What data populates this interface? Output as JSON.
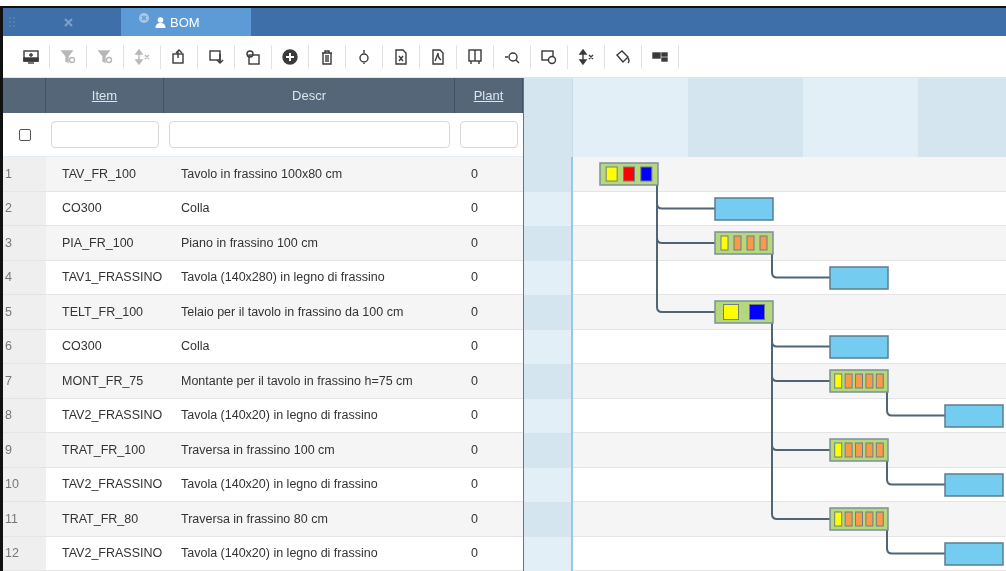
{
  "tabs": [
    {
      "selected": false,
      "closable": true
    },
    {
      "label": "BOM",
      "selected": true,
      "closable": true
    }
  ],
  "toolbar": [
    {
      "kind": "monitor",
      "disabled": false
    },
    {
      "kind": "filter-clear",
      "disabled": true
    },
    {
      "kind": "filter",
      "disabled": true
    },
    {
      "kind": "arrows-clear",
      "disabled": true
    },
    {
      "kind": "export",
      "disabled": false
    },
    {
      "kind": "import",
      "disabled": false
    },
    {
      "kind": "settings-doc",
      "disabled": false
    },
    {
      "kind": "add",
      "disabled": false
    },
    {
      "kind": "delete",
      "disabled": false
    },
    {
      "kind": "zoom",
      "disabled": false
    },
    {
      "kind": "excel",
      "disabled": false
    },
    {
      "kind": "pdf",
      "disabled": false
    },
    {
      "kind": "book",
      "disabled": false
    },
    {
      "kind": "find",
      "disabled": false
    },
    {
      "kind": "image-refresh",
      "disabled": false
    },
    {
      "kind": "merge",
      "disabled": false
    },
    {
      "kind": "paint",
      "disabled": false
    },
    {
      "kind": "blocks",
      "disabled": false
    }
  ],
  "table": {
    "columns": [
      {
        "label": "Item",
        "sortable": true
      },
      {
        "label": "Descr",
        "sortable": false
      },
      {
        "label": "Plant",
        "sortable": true
      }
    ],
    "select_all": {
      "checked": false
    },
    "bom": [
      {
        "no": "1",
        "item": "TAV_FR_100",
        "descr": "Tavolo in frassino 100x80 cm",
        "plant": "0",
        "kind": "assembly",
        "marks": [
          {
            "color": "#ffff00"
          },
          {
            "color": "#ff0000"
          },
          {
            "color": "#0000ff"
          }
        ],
        "children": [
          {
            "no": "2",
            "item": "CO300",
            "descr": "Colla",
            "plant": "0",
            "kind": "part"
          },
          {
            "no": "3",
            "item": "PIA_FR_100",
            "descr": "Piano in frassino 100 cm",
            "plant": "0",
            "kind": "assembly",
            "marks": [
              {
                "color": "#ffff00"
              },
              {
                "color": "#f79a4a"
              },
              {
                "color": "#f79a4a"
              },
              {
                "color": "#f79a4a"
              }
            ],
            "children": [
              {
                "no": "4",
                "item": "TAV1_FRASSINO",
                "descr": "Tavola (140x280) in legno di frassino",
                "plant": "0",
                "kind": "part"
              }
            ]
          },
          {
            "no": "5",
            "item": "TELT_FR_100",
            "descr": "Telaio per il tavolo in frassino da 100 cm",
            "plant": "0",
            "kind": "assembly",
            "marks": [
              {
                "color": "#ffff00"
              },
              {
                "color": "#0000ff"
              }
            ],
            "children": [
              {
                "no": "6",
                "item": "CO300",
                "descr": "Colla",
                "plant": "0",
                "kind": "part"
              },
              {
                "no": "7",
                "item": "MONT_FR_75",
                "descr": "Montante per il tavolo in frassino h=75 cm",
                "plant": "0",
                "kind": "assembly",
                "marks": [
                  {
                    "color": "#ffff00"
                  },
                  {
                    "color": "#f79a4a"
                  },
                  {
                    "color": "#f79a4a"
                  },
                  {
                    "color": "#f79a4a"
                  },
                  {
                    "color": "#f79a4a"
                  }
                ],
                "children": [
                  {
                    "no": "8",
                    "item": "TAV2_FRASSINO",
                    "descr": "Tavola (140x20) in legno di frassino",
                    "plant": "0",
                    "kind": "part"
                  }
                ]
              },
              {
                "no": "9",
                "item": "TRAT_FR_100",
                "descr": "Traversa in frassino 100 cm",
                "plant": "0",
                "kind": "assembly",
                "marks": [
                  {
                    "color": "#ffff00"
                  },
                  {
                    "color": "#f79a4a"
                  },
                  {
                    "color": "#f79a4a"
                  },
                  {
                    "color": "#f79a4a"
                  },
                  {
                    "color": "#f79a4a"
                  }
                ],
                "children": [
                  {
                    "no": "10",
                    "item": "TAV2_FRASSINO",
                    "descr": "Tavola (140x20) in legno di frassino",
                    "plant": "0",
                    "kind": "part"
                  }
                ]
              },
              {
                "no": "11",
                "item": "TRAT_FR_80",
                "descr": "Traversa in frassino 80 cm",
                "plant": "0",
                "kind": "assembly",
                "marks": [
                  {
                    "color": "#ffff00"
                  },
                  {
                    "color": "#f79a4a"
                  },
                  {
                    "color": "#f79a4a"
                  },
                  {
                    "color": "#f79a4a"
                  },
                  {
                    "color": "#f79a4a"
                  }
                ],
                "children": [
                  {
                    "no": "12",
                    "item": "TAV2_FRASSINO",
                    "descr": "Tavola (140x20) in legno di frassino",
                    "plant": "0",
                    "kind": "part"
                  }
                ]
              }
            ]
          }
        ]
      }
    ]
  }
}
